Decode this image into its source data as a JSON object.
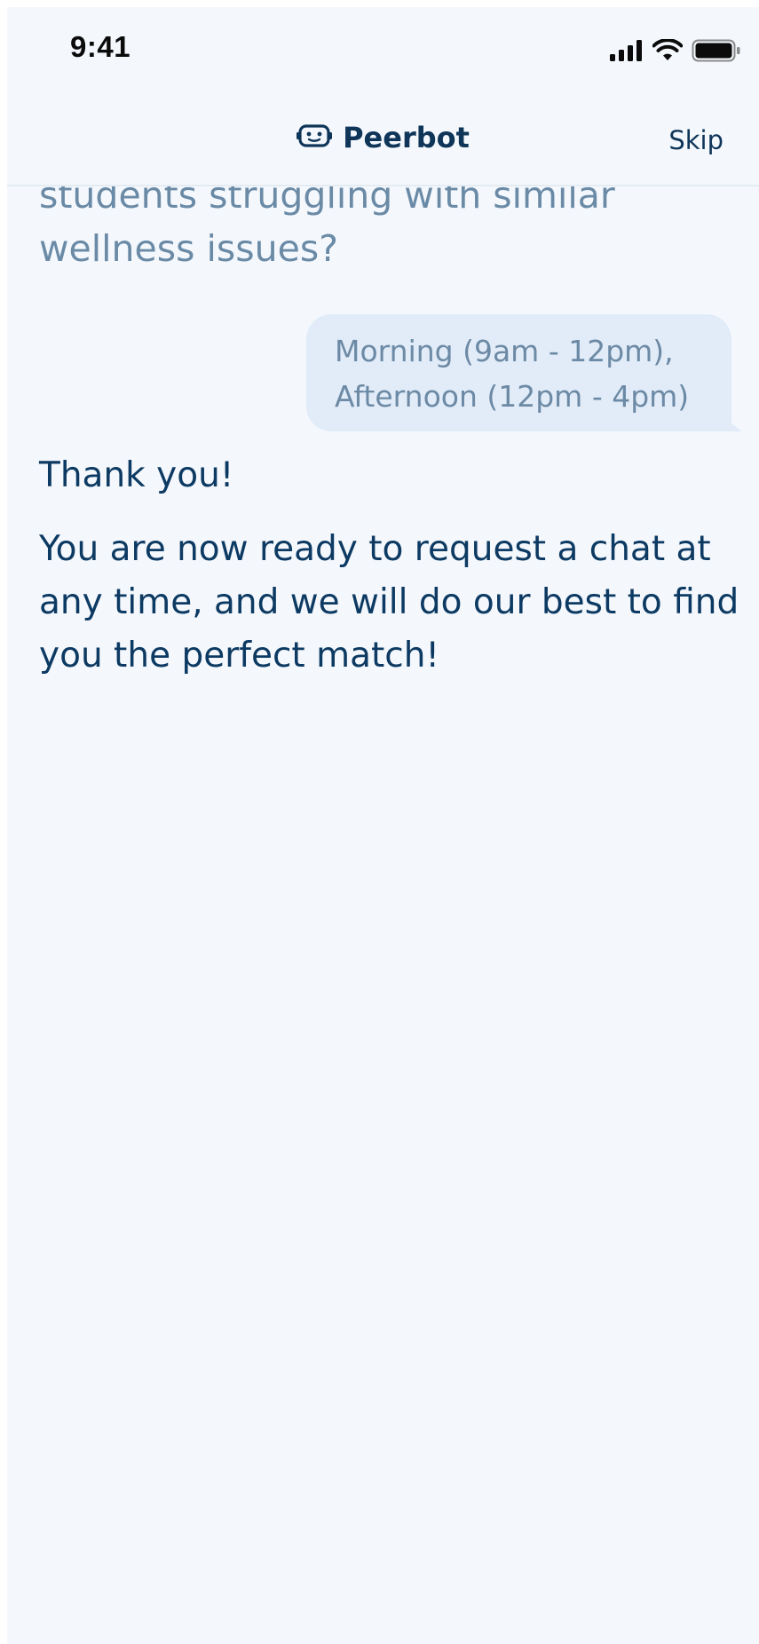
{
  "status_bar": {
    "time": "9:41",
    "icons": [
      "cellular-signal-icon",
      "wifi-icon",
      "battery-icon"
    ]
  },
  "nav": {
    "title": "Peerbot",
    "logo_icon": "robot-face-icon",
    "skip_label": "Skip"
  },
  "chat": {
    "bot_question": "students struggling with similar wellness issues?",
    "user_reply": "Morning (9am - 12pm),\nAfternoon (12pm - 4pm)",
    "bot_thanks": "Thank you!",
    "bot_ready": "You are now ready to request a chat at any time, and we will do our best to find you the perfect match!"
  },
  "colors": {
    "background": "#f4f8fd",
    "primary_text": "#0d3a62",
    "muted_text": "#6a8aa6",
    "bubble": "#e2ecf8"
  }
}
